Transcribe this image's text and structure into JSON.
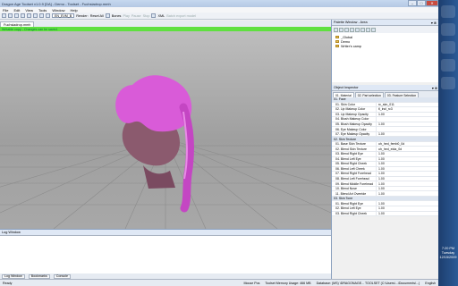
{
  "window": {
    "title": "Dragon Age Toolset v1.0.9 [DA] - Demo - Toolset - Fuchsiadrop.mmh"
  },
  "menu": [
    "File",
    "Edit",
    "View",
    "Tools",
    "Window",
    "Help"
  ],
  "toolbar": {
    "dropdown": "EN_EVM_B",
    "render_label": "Render:",
    "reset_label": "Reset All",
    "bones_label": "Bones",
    "play_label": "Play",
    "pause_label": "Pause",
    "stop_label": "Stop",
    "xml_label": "XML",
    "batch_label": "Batch export model"
  },
  "document": {
    "tab": "Fuchsiadrop.mmh",
    "status_banner": "Writable copy - Changes can be saved."
  },
  "log": {
    "title": "Log Window",
    "tabs": [
      "Log Window",
      "Bookmarks",
      "Console"
    ]
  },
  "palette": {
    "title": "Palette Window - Area",
    "items": [
      "_Global",
      "Demo",
      "Writer's camp"
    ]
  },
  "inspector": {
    "title": "Object Inspector",
    "tabs": [
      "01. Material",
      "02. Part selection",
      "03. Feature Selection"
    ],
    "rows": [
      {
        "name": "01. Face",
        "value": "",
        "cat": true
      },
      {
        "name": "01. Skin Color",
        "value": "rc_skn_011",
        "cat": false
      },
      {
        "name": "02. Lip Makeup Color",
        "value": "tl_incl_rc3",
        "cat": false
      },
      {
        "name": "03. Lip Makeup Opacity",
        "value": "1.00",
        "cat": false
      },
      {
        "name": "04. Blush Makeup Color",
        "value": "",
        "cat": false
      },
      {
        "name": "05. Blush Makeup Opacity",
        "value": "1.00",
        "cat": false
      },
      {
        "name": "06. Eye Makeup Color",
        "value": "",
        "cat": false
      },
      {
        "name": "07. Eye Makeup Opacity",
        "value": "1.00",
        "cat": false
      },
      {
        "name": "02. Skin Texture",
        "value": "",
        "cat": true
      },
      {
        "name": "01. Base Skin Texture",
        "value": "uh_hed_femb0_0d",
        "cat": false
      },
      {
        "name": "02. Blend Skin Texture",
        "value": "uh_hed_eida_0d",
        "cat": false
      },
      {
        "name": "03. Blend Right Eye",
        "value": "1.00",
        "cat": false
      },
      {
        "name": "04. Blend Left Eye",
        "value": "1.00",
        "cat": false
      },
      {
        "name": "05. Blend Right Cheek",
        "value": "1.00",
        "cat": false
      },
      {
        "name": "06. Blend Left Cheek",
        "value": "1.00",
        "cat": false
      },
      {
        "name": "07. Blend Right Forehead",
        "value": "1.00",
        "cat": false
      },
      {
        "name": "08. Blend Left Forehead",
        "value": "1.00",
        "cat": false
      },
      {
        "name": "09. Blend Middle Forehead",
        "value": "1.00",
        "cat": false
      },
      {
        "name": "10. Blend Nose",
        "value": "1.00",
        "cat": false
      },
      {
        "name": "11. Blend Art Override",
        "value": "1.00",
        "cat": false
      },
      {
        "name": "03. Skin Tone",
        "value": "",
        "cat": true
      },
      {
        "name": "01. Blend Right Eye",
        "value": "1.00",
        "cat": false
      },
      {
        "name": "02. Blend Left Eye",
        "value": "1.00",
        "cat": false
      },
      {
        "name": "03. Blend Right Cheek",
        "value": "1.00",
        "cat": false
      }
    ]
  },
  "statusbar": {
    "ready": "Ready",
    "mouse_pos": "Mouse Pos",
    "memory": "Toolset Memory Usage: 466 MB",
    "database": "Database: (MS) \\DRAGONAGE... TOOLSET (C:\\Users\\...\\Documents\\...)",
    "language": "English"
  },
  "clock": {
    "time": "7:20 PM",
    "day": "Tuesday",
    "date": "12/15/2009"
  },
  "colors": {
    "accent_green": "#5fe040",
    "hair": "#d95bd8",
    "taskbar": "#1d3e6e"
  }
}
